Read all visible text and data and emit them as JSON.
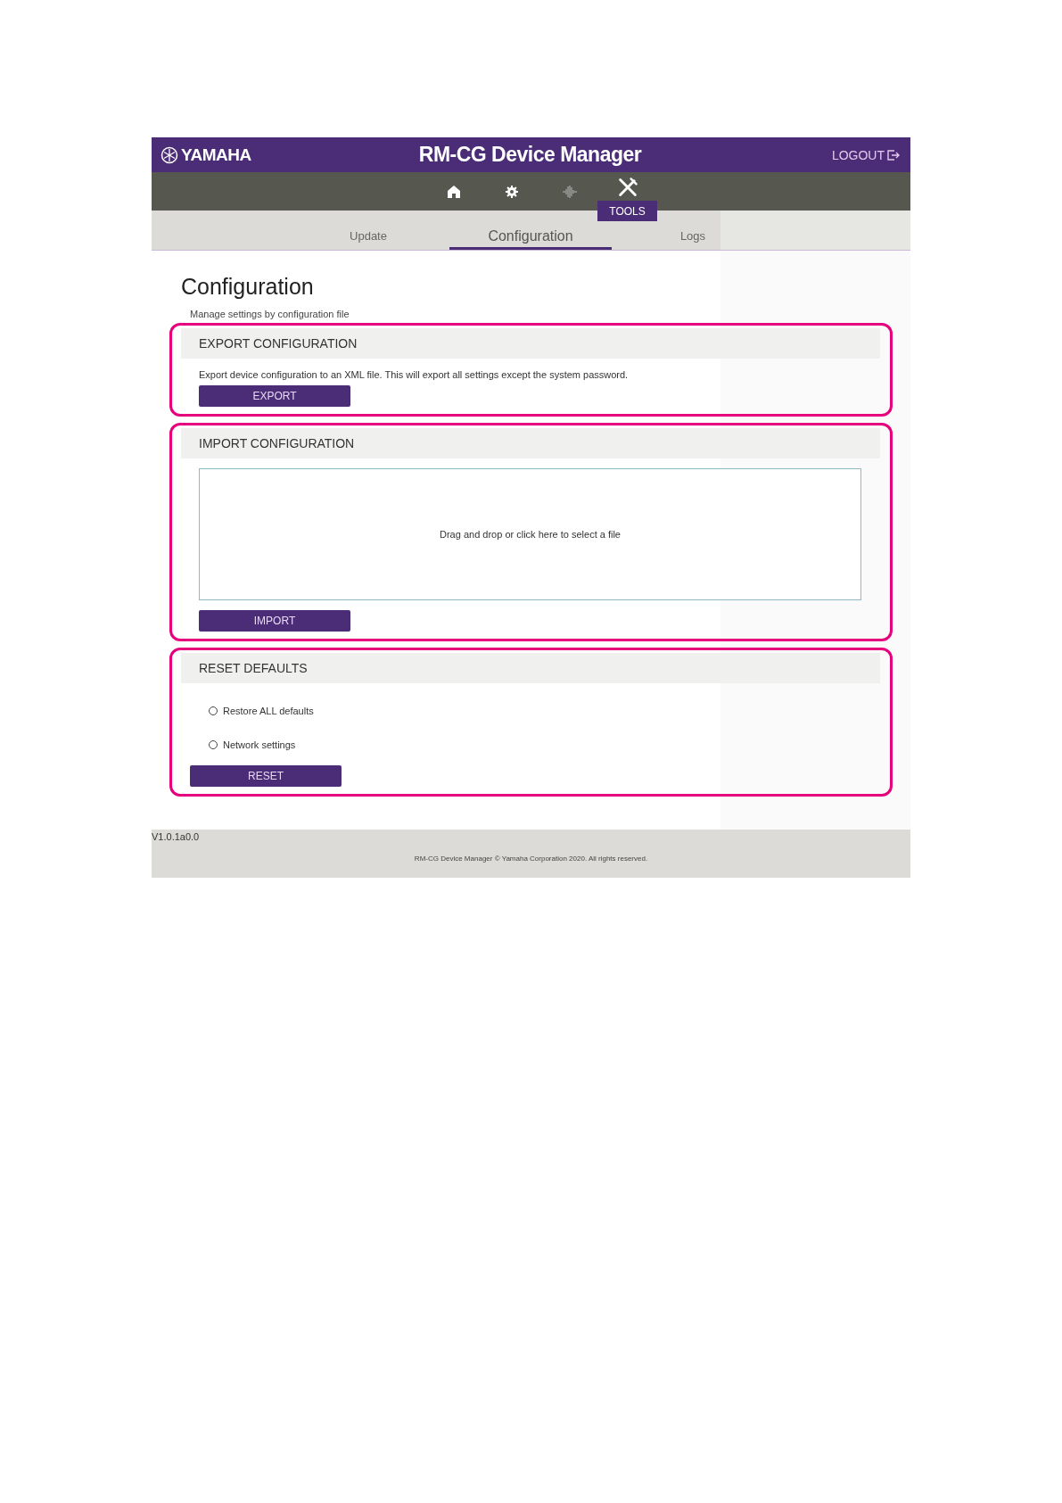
{
  "header": {
    "logo": "YAMAHA",
    "title": "RM-CG Device Manager",
    "logout": "LOGOUT"
  },
  "nav": [
    {
      "kind": "home",
      "selected": false
    },
    {
      "kind": "settings",
      "selected": false
    },
    {
      "kind": "audio",
      "selected": false
    },
    {
      "kind": "tools",
      "selected": true,
      "label": "TOOLS"
    }
  ],
  "tabs": [
    {
      "label": "Update",
      "selected": false
    },
    {
      "label": "Configuration",
      "selected": true
    },
    {
      "label": "Logs",
      "selected": false
    }
  ],
  "page": {
    "title": "Configuration",
    "subtitle": "Manage settings by configuration file"
  },
  "sections": [
    {
      "kind": "export",
      "highlighted": true,
      "title": "EXPORT CONFIGURATION",
      "description": "Export device configuration to an XML file. This will export all settings except the system password.",
      "button": "EXPORT"
    },
    {
      "kind": "import",
      "highlighted": true,
      "title": "IMPORT CONFIGURATION",
      "dropzone": "Drag and drop or click here to select a file",
      "button": "IMPORT"
    },
    {
      "kind": "reset",
      "highlighted": true,
      "title": "RESET DEFAULTS",
      "options": [
        {
          "label": "Restore ALL defaults",
          "selected": false
        },
        {
          "label": "Network settings",
          "selected": false
        }
      ],
      "button": "RESET"
    }
  ],
  "footer": {
    "version": "V1.0.1a0.0",
    "copyright": "RM-CG Device Manager © Yamaha Corporation 2020. All rights reserved."
  }
}
